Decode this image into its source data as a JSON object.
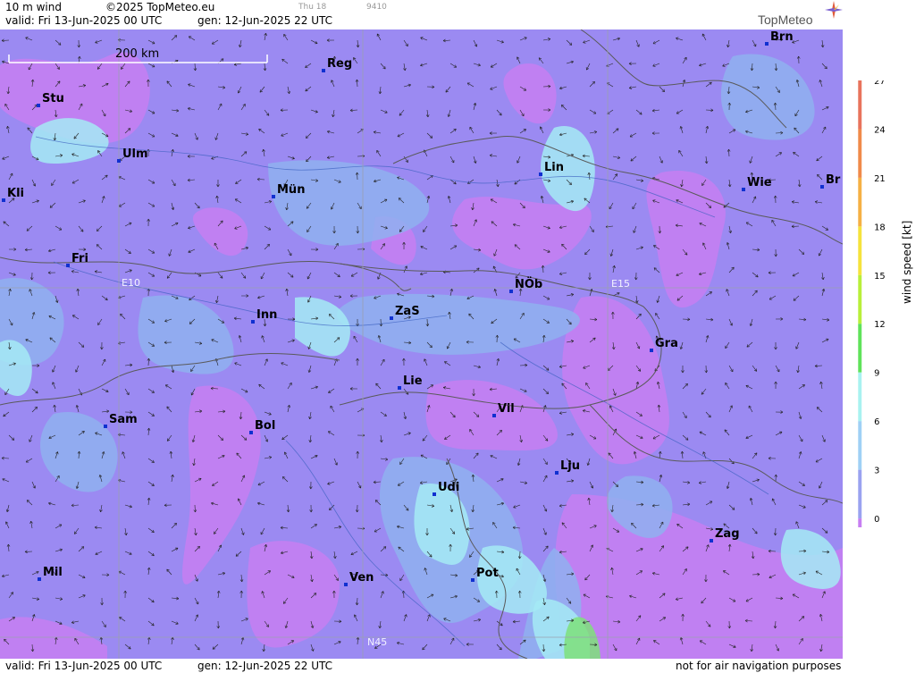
{
  "header": {
    "product": "10 m wind",
    "copyright": "©2025 TopMeteo.eu",
    "day_small": "Thu 18",
    "code_small": "9410",
    "valid": "valid:  Fri  13-Jun-2025  00 UTC",
    "gen": "gen: 12-Jun-2025 22 UTC",
    "logo": "TopMeteo"
  },
  "footer": {
    "valid": "valid:  Fri  13-Jun-2025  00 UTC",
    "gen": "gen: 12-Jun-2025 22 UTC",
    "disclaimer": "not for air navigation purposes"
  },
  "map": {
    "scale_label": "200 km",
    "grid_labels": [
      "E10",
      "E15",
      "N45"
    ],
    "cities": [
      {
        "name": "Reg"
      },
      {
        "name": "Brn"
      },
      {
        "name": "Stu"
      },
      {
        "name": "Ulm"
      },
      {
        "name": "Lin"
      },
      {
        "name": "Kli"
      },
      {
        "name": "Mün"
      },
      {
        "name": "Wie"
      },
      {
        "name": "Br"
      },
      {
        "name": "Fri"
      },
      {
        "name": "NÖb"
      },
      {
        "name": "Inn"
      },
      {
        "name": "ZaS"
      },
      {
        "name": "Gra"
      },
      {
        "name": "Lie"
      },
      {
        "name": "Vil"
      },
      {
        "name": "Sam"
      },
      {
        "name": "Bol"
      },
      {
        "name": "Lju"
      },
      {
        "name": "Udi"
      },
      {
        "name": "Zag"
      },
      {
        "name": "Mil"
      },
      {
        "name": "Ven"
      },
      {
        "name": "Pot"
      }
    ],
    "colors": {
      "calm": "#c77ef2",
      "light": "#9b8af2",
      "moderate": "#8fb0f0",
      "fresh": "#a5eaf5",
      "strong": "#7ee07a"
    }
  },
  "legend": {
    "title": "wind  speed  [kt]",
    "ticks": [
      "27",
      "24",
      "21",
      "18",
      "15",
      "12",
      "9",
      "6",
      "3",
      "0"
    ],
    "colors": [
      "#e8735c",
      "#f08a4a",
      "#f5b044",
      "#f5e23c",
      "#b8ef3a",
      "#5fe25a",
      "#a8f2f0",
      "#9fd0f5",
      "#9aa2f0",
      "#c77ef2"
    ]
  }
}
